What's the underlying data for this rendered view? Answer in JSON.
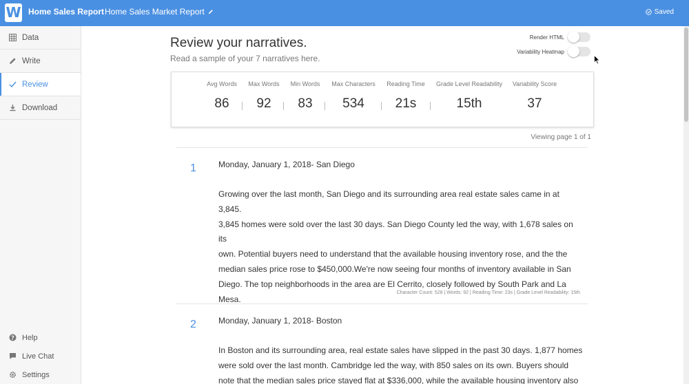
{
  "topbar": {
    "logo_letter": "W",
    "app_title": "Home Sales Report",
    "doc_title": "Home Sales Market Report",
    "saved_label": "Saved"
  },
  "sidebar": {
    "items": [
      {
        "label": "Data",
        "icon": "grid-icon"
      },
      {
        "label": "Write",
        "icon": "pencil-icon"
      },
      {
        "label": "Review",
        "icon": "check-icon",
        "active": true
      },
      {
        "label": "Download",
        "icon": "download-icon"
      }
    ],
    "bottom": [
      {
        "label": "Help",
        "icon": "help-icon"
      },
      {
        "label": "Live Chat",
        "icon": "chat-icon"
      },
      {
        "label": "Settings",
        "icon": "gear-icon"
      }
    ]
  },
  "main": {
    "title": "Review your narratives.",
    "subtitle": "Read a sample of your 7 narratives here.",
    "toggles": {
      "render_html": "Render HTML",
      "variability_heatmap": "Variability Heatmap"
    },
    "stats": [
      {
        "label": "Avg Words",
        "value": "86"
      },
      {
        "label": "Max Words",
        "value": "92"
      },
      {
        "label": "Min Words",
        "value": "83"
      },
      {
        "label": "Max Characters",
        "value": "534"
      },
      {
        "label": "Reading Time",
        "value": "21s"
      },
      {
        "label": "Grade Level Readability",
        "value": "15th"
      },
      {
        "label": "Variability Score",
        "value": "37"
      }
    ],
    "viewing": "Viewing page 1 of 1",
    "narratives": [
      {
        "number": "1",
        "heading": "Monday, January 1, 2018- San Diego",
        "lines": [
          "Growing over the last month, San Diego and its surrounding area real estate sales came in at 3,845.",
          "3,845 homes were sold over the last 30 days. San Diego County led the way, with 1,678 sales on its",
          "own. Potential buyers need to understand that  the available housing inventory rose, and the the",
          "median sales price rose to $450,000.We're now seeing four months of inventory available in San",
          "Diego. The top neighborhoods in the area are El Cerrito, closely followed by South Park and  La",
          "Mesa."
        ],
        "meta": "Character Count: 528 | Words: 92 | Reading Time: 23s | Grade Level Readability: 15th"
      },
      {
        "number": "2",
        "heading": "Monday, January 1, 2018- Boston",
        "lines": [
          "In Boston and its surrounding area, real estate sales have slipped in the past 30 days. 1,877 homes",
          "were sold over the last month. Cambridge led the way, with 850 sales on its own. Buyers should",
          "note that the median sales price stayed flat at $336,000, while the available housing inventory also"
        ]
      }
    ]
  },
  "colors": {
    "accent": "#4a90e2",
    "sidebar_bg": "#f6f6f6"
  }
}
